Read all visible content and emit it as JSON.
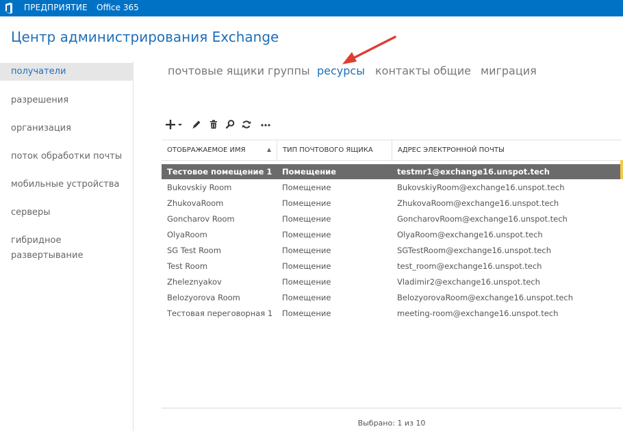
{
  "topbar": {
    "nav1": "ПРЕДПРИЯТИЕ",
    "nav2": "Office 365"
  },
  "app": {
    "title": "Центр администрирования Exchange"
  },
  "sidebar": {
    "items": [
      {
        "label": "получатели",
        "active": true
      },
      {
        "label": "разрешения"
      },
      {
        "label": "организация"
      },
      {
        "label": "поток обработки почты"
      },
      {
        "label": "мобильные устройства"
      },
      {
        "label": "серверы"
      },
      {
        "label": "гибридное развертывание"
      }
    ]
  },
  "tabs": [
    {
      "label": "почтовые ящики"
    },
    {
      "label": "группы"
    },
    {
      "label": "ресурсы",
      "active": true
    },
    {
      "label": "контакты"
    },
    {
      "label": "общие"
    },
    {
      "label": "миграция"
    }
  ],
  "toolbar": {
    "icons": [
      "add-icon",
      "edit-icon",
      "delete-icon",
      "search-icon",
      "refresh-icon",
      "more-icon"
    ]
  },
  "table": {
    "columns": [
      "ОТОБРАЖАЕМОЕ ИМЯ",
      "ТИП ПОЧТОВОГО ЯЩИКА",
      "АДРЕС ЭЛЕКТРОННОЙ ПОЧТЫ"
    ],
    "rows": [
      [
        "Тестовое помещение 1",
        "Помещение",
        "testmr1@exchange16.unspot.tech"
      ],
      [
        "Bukovskiy Room",
        "Помещение",
        "BukovskiyRoom@exchange16.unspot.tech"
      ],
      [
        "ZhukovaRoom",
        "Помещение",
        "ZhukovaRoom@exchange16.unspot.tech"
      ],
      [
        "Goncharov Room",
        "Помещение",
        "GoncharovRoom@exchange16.unspot.tech"
      ],
      [
        "OlyaRoom",
        "Помещение",
        "OlyaRoom@exchange16.unspot.tech"
      ],
      [
        "SG Test Room",
        "Помещение",
        "SGTestRoom@exchange16.unspot.tech"
      ],
      [
        "Test Room",
        "Помещение",
        "test_room@exchange16.unspot.tech"
      ],
      [
        "Zheleznyakov",
        "Помещение",
        "Vladimir2@exchange16.unspot.tech"
      ],
      [
        "Belozyorova Room",
        "Помещение",
        "BelozyorovaRoom@exchange16.unspot.tech"
      ],
      [
        "Тестовая переговорная 1",
        "Помещение",
        "meeting-room@exchange16.unspot.tech"
      ]
    ],
    "selected_row": 0
  },
  "footer": {
    "status": "Выбрано: 1 из 10"
  },
  "colors": {
    "accent": "#0072c6",
    "title_blue": "#1f6fb8",
    "arrow": "#e03c31",
    "selected_row": "#6b6b6b"
  }
}
